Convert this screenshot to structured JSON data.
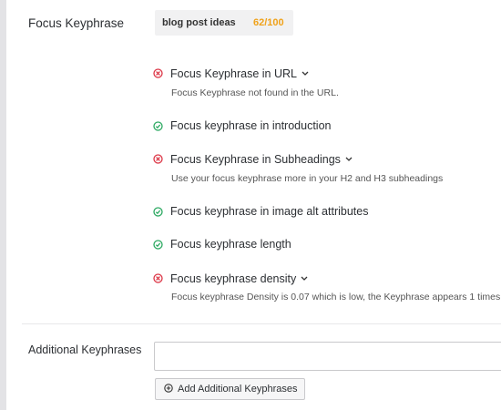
{
  "focus_keyphrase": {
    "label": "Focus Keyphrase",
    "value": "blog post ideas",
    "score": "62/100",
    "score_color": "#f0a21a"
  },
  "checks": [
    {
      "status": "fail",
      "title": "Focus Keyphrase in URL",
      "expandable": true,
      "description": "Focus Keyphrase not found in the URL."
    },
    {
      "status": "pass",
      "title": "Focus keyphrase in introduction",
      "expandable": false,
      "description": ""
    },
    {
      "status": "fail",
      "title": "Focus Keyphrase in Subheadings",
      "expandable": true,
      "description": "Use your focus keyphrase more in your H2 and H3 subheadings"
    },
    {
      "status": "pass",
      "title": "Focus keyphrase in image alt attributes",
      "expandable": false,
      "description": ""
    },
    {
      "status": "pass",
      "title": "Focus keyphrase length",
      "expandable": false,
      "description": ""
    },
    {
      "status": "fail",
      "title": "Focus keyphrase density",
      "expandable": true,
      "description": "Focus keyphrase Density is 0.07 which is low, the Keyphrase appears 1 times."
    }
  ],
  "additional": {
    "label": "Additional Keyphrases",
    "input_value": "",
    "button_label": "Add Additional Keyphrases"
  },
  "colors": {
    "pass": "#2aa860",
    "fail": "#dc3545"
  }
}
